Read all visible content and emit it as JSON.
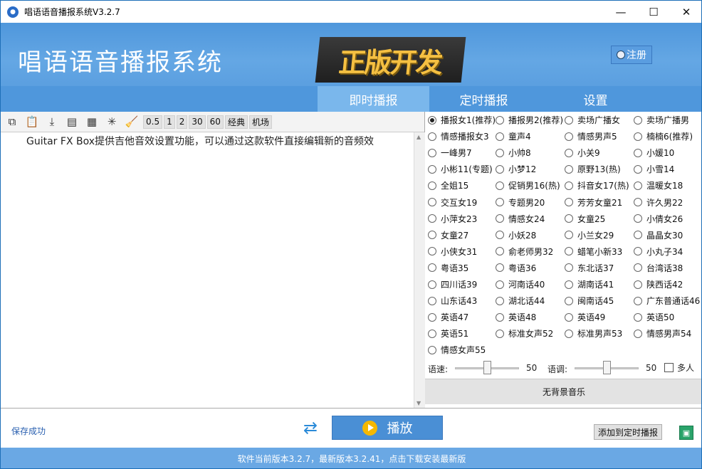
{
  "window": {
    "title": "唱语语音播报系统V3.2.7",
    "minimize": "—",
    "maximize": "☐",
    "close": "✕"
  },
  "header": {
    "app_name": "唱语语音播报系统",
    "banner": "正版开发",
    "register": "注册"
  },
  "tabs": [
    "即时播报",
    "定时播报",
    "设置"
  ],
  "toolbar": {
    "speeds": [
      "0.5",
      "1",
      "2",
      "30",
      "60",
      "经典",
      "机场"
    ]
  },
  "editor": {
    "text": "Guitar FX Box提供吉他音效设置功能，可以通过这款软件直接编辑新的音频效"
  },
  "voices": [
    [
      "播报女1(推荐)",
      "播报男2(推荐)",
      "卖场广播女",
      "卖场广播男"
    ],
    [
      "情感播报女3",
      "童声4",
      "情感男声5",
      "楠楠6(推荐)"
    ],
    [
      "一峰男7",
      "小帅8",
      "小关9",
      "小媛10"
    ],
    [
      "小彬11(专题)",
      "小梦12",
      "原野13(热)",
      "小雪14"
    ],
    [
      "全姐15",
      "促销男16(热)",
      "抖音女17(热)",
      "温暖女18"
    ],
    [
      "交互女19",
      "专题男20",
      "芳芳女童21",
      "许久男22"
    ],
    [
      "小萍女23",
      "情感女24",
      "女童25",
      "小倩女26"
    ],
    [
      "女童27",
      "小妖28",
      "小兰女29",
      "晶晶女30"
    ],
    [
      "小侠女31",
      "俞老师男32",
      "蜡笔小新33",
      "小丸子34"
    ],
    [
      "粤语35",
      "粤语36",
      "东北话37",
      "台湾话38"
    ],
    [
      "四川话39",
      "河南话40",
      "湖南话41",
      "陕西话42"
    ],
    [
      "山东话43",
      "湖北话44",
      "闽南话45",
      "广东普通话46"
    ],
    [
      "英语47",
      "英语48",
      "英语49",
      "英语50"
    ],
    [
      "英语51",
      "标准女声52",
      "标准男声53",
      "情感男声54"
    ],
    [
      "情感女声55"
    ]
  ],
  "selected_voice": "播报女1(推荐)",
  "speed": {
    "label": "语速:",
    "value": "50"
  },
  "pitch": {
    "label": "语调:",
    "value": "50"
  },
  "multi": {
    "label": "多人",
    "checked": false
  },
  "bgm": "无背景音乐",
  "bottom": {
    "status": "保存成功",
    "play": "播放",
    "add_timed": "添加到定时播报"
  },
  "footer": "软件当前版本3.2.7，最新版本3.2.41，点击下载安装最新版",
  "colors": {
    "accent": "#4f97dc",
    "play": "#4a8fd5",
    "active_tab": "#7ab7ec",
    "icon_play": "#f5b800"
  }
}
